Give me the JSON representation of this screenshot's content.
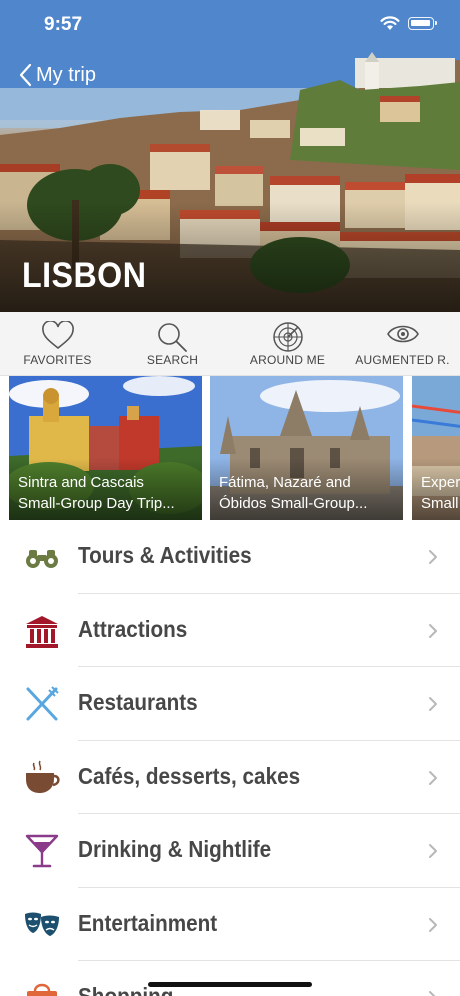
{
  "status_bar": {
    "time": "9:57"
  },
  "nav": {
    "back_label": "My trip"
  },
  "hero": {
    "city_title": "LISBON"
  },
  "actions": [
    {
      "label": "FAVORITES",
      "icon": "heart-icon"
    },
    {
      "label": "SEARCH",
      "icon": "search-icon"
    },
    {
      "label": "AROUND ME",
      "icon": "radar-icon"
    },
    {
      "label": "AUGMENTED R.",
      "icon": "eye-icon"
    }
  ],
  "tours": [
    {
      "title": "Sintra and Cascais\nSmall-Group Day Trip..."
    },
    {
      "title": "Fátima, Nazaré and\nÓbidos Small-Group..."
    },
    {
      "title": "Exper\nSmall"
    }
  ],
  "categories": [
    {
      "label": "Tours & Activities",
      "icon": "binoculars-icon",
      "color": "#6b7b43"
    },
    {
      "label": "Attractions",
      "icon": "museum-icon",
      "color": "#a3172b"
    },
    {
      "label": "Restaurants",
      "icon": "fork-knife-icon",
      "color": "#5aa7e0"
    },
    {
      "label": "Cafés, desserts, cakes",
      "icon": "coffee-cup-icon",
      "color": "#7a4b33"
    },
    {
      "label": "Drinking & Nightlife",
      "icon": "cocktail-icon",
      "color": "#8a3b8a"
    },
    {
      "label": "Entertainment",
      "icon": "theater-masks-icon",
      "color": "#1d4f6e"
    },
    {
      "label": "Shopping",
      "icon": "shopping-bag-icon",
      "color": "#e0673a"
    }
  ]
}
